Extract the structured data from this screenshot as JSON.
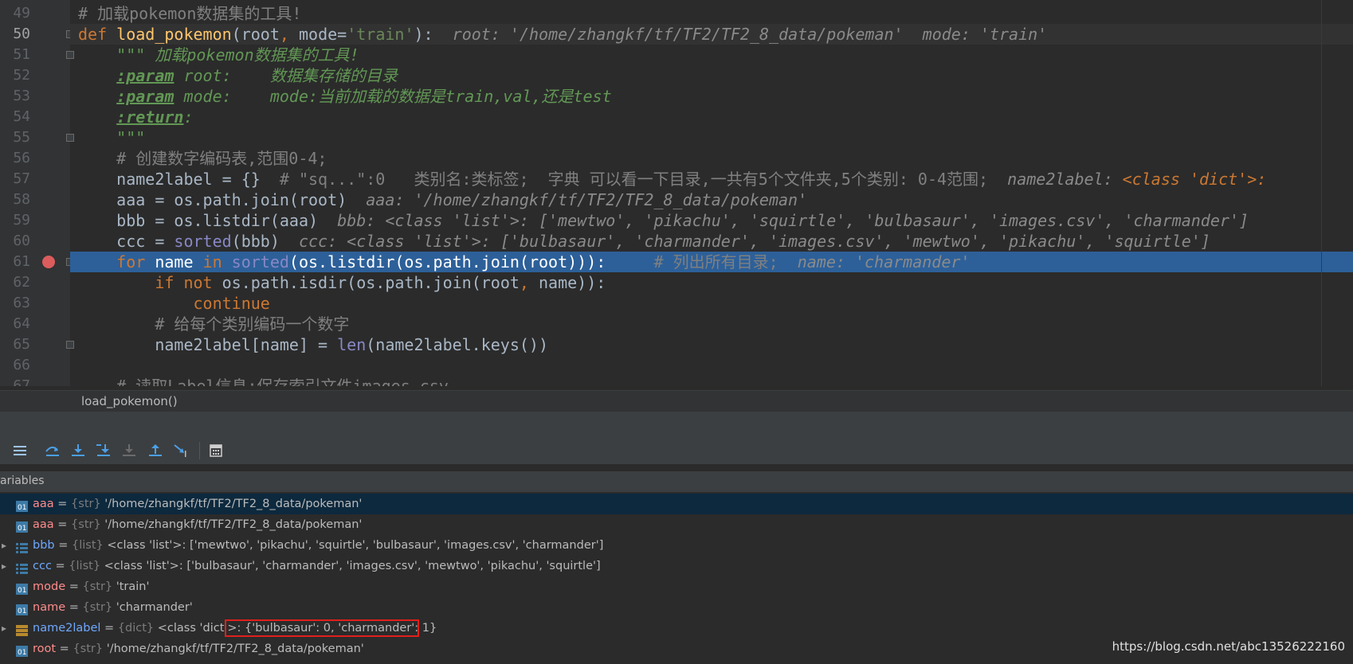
{
  "editor": {
    "lines": [
      {
        "num": "49",
        "segs": [
          {
            "c": "cm",
            "t": "# 加载pokemon数据集的工具!"
          }
        ]
      },
      {
        "num": "50",
        "current": true,
        "segs": [
          {
            "c": "kw",
            "t": "def "
          },
          {
            "c": "fn",
            "t": "load_pokemon"
          },
          {
            "c": "",
            "t": "(root"
          },
          {
            "c": "kw",
            "t": ", "
          },
          {
            "c": "",
            "t": "mode="
          },
          {
            "c": "str",
            "t": "'train'"
          },
          {
            "c": "",
            "t": "):  "
          },
          {
            "c": "hint",
            "t": "root: '/home/zhangkf/tf/TF2/TF2_8_data/pokeman'  mode: 'train'"
          }
        ]
      },
      {
        "num": "51",
        "segs": [
          {
            "c": "doc",
            "t": "    \"\"\" 加载pokemon数据集的工具!"
          }
        ]
      },
      {
        "num": "52",
        "segs": [
          {
            "c": "doc",
            "t": "    "
          },
          {
            "c": "tag",
            "t": ":param"
          },
          {
            "c": "doc",
            "t": " root:    数据集存储的目录"
          }
        ]
      },
      {
        "num": "53",
        "segs": [
          {
            "c": "doc",
            "t": "    "
          },
          {
            "c": "tag",
            "t": ":param"
          },
          {
            "c": "doc",
            "t": " mode:    mode:当前加载的数据是train,val,还是test"
          }
        ]
      },
      {
        "num": "54",
        "segs": [
          {
            "c": "doc",
            "t": "    "
          },
          {
            "c": "tag",
            "t": ":return"
          },
          {
            "c": "doc",
            "t": ":"
          }
        ]
      },
      {
        "num": "55",
        "segs": [
          {
            "c": "doc",
            "t": "    \"\"\""
          }
        ]
      },
      {
        "num": "56",
        "segs": [
          {
            "c": "cm",
            "t": "    # 创建数字编码表,范围0-4;"
          }
        ]
      },
      {
        "num": "57",
        "segs": [
          {
            "c": "",
            "t": "    name2label = {}  "
          },
          {
            "c": "cm",
            "t": "# \"sq...\":0   类别名:类标签;  字典 可以看一下目录,一共有5个文件夹,5个类别: 0-4范围;  "
          },
          {
            "c": "hint",
            "t": "name2label: "
          },
          {
            "c": "hintcls",
            "t": "<class 'dict'>:"
          }
        ]
      },
      {
        "num": "58",
        "segs": [
          {
            "c": "",
            "t": "    aaa = os.path.join(root)  "
          },
          {
            "c": "hint",
            "t": "aaa: '/home/zhangkf/tf/TF2/TF2_8_data/pokeman'"
          }
        ]
      },
      {
        "num": "59",
        "segs": [
          {
            "c": "",
            "t": "    bbb = os.listdir(aaa)  "
          },
          {
            "c": "hint",
            "t": "bbb: <class 'list'>: ['mewtwo', 'pikachu', 'squirtle', 'bulbasaur', 'images.csv', 'charmander']"
          }
        ]
      },
      {
        "num": "60",
        "segs": [
          {
            "c": "",
            "t": "    ccc = "
          },
          {
            "c": "bi",
            "t": "sorted"
          },
          {
            "c": "",
            "t": "(bbb)  "
          },
          {
            "c": "hint",
            "t": "ccc: <class 'list'>: ['bulbasaur', 'charmander', 'images.csv', 'mewtwo', 'pikachu', 'squirtle']"
          }
        ]
      },
      {
        "num": "61",
        "exec": true,
        "segs": [
          {
            "c": "kw",
            "t": "    for "
          },
          {
            "c": "",
            "t": "name "
          },
          {
            "c": "kw",
            "t": "in "
          },
          {
            "c": "bi",
            "t": "sorted"
          },
          {
            "c": "",
            "t": "(os.listdir(os.path.join(root))):     "
          },
          {
            "c": "cm",
            "t": "# 列出所有目录;  "
          },
          {
            "c": "hint",
            "t": "name: 'charmander'"
          }
        ]
      },
      {
        "num": "62",
        "segs": [
          {
            "c": "kw",
            "t": "        if not "
          },
          {
            "c": "",
            "t": "os.path.isdir(os.path.join(root"
          },
          {
            "c": "kw",
            "t": ", "
          },
          {
            "c": "",
            "t": "name)):"
          }
        ]
      },
      {
        "num": "63",
        "segs": [
          {
            "c": "kw",
            "t": "            continue"
          }
        ]
      },
      {
        "num": "64",
        "segs": [
          {
            "c": "cm",
            "t": "        # 给每个类别编码一个数字"
          }
        ]
      },
      {
        "num": "65",
        "segs": [
          {
            "c": "",
            "t": "        name2label[name] = "
          },
          {
            "c": "bi",
            "t": "len"
          },
          {
            "c": "",
            "t": "(name2label.keys())"
          }
        ]
      },
      {
        "num": "66",
        "segs": [
          {
            "c": "",
            "t": ""
          }
        ]
      },
      {
        "num": "67",
        "segs": [
          {
            "c": "cm",
            "t": "    # 读取Label信息;保存索引文件images.csv"
          }
        ]
      }
    ]
  },
  "breadcrumb": {
    "label": "load_pokemon()"
  },
  "variables": {
    "header": "ariables",
    "rows": [
      {
        "expand": false,
        "icon": "str",
        "name": "aaa",
        "kind": "str",
        "type": "{str}",
        "value": " '/home/zhangkf/tf/TF2/TF2_8_data/pokeman'",
        "selected": true
      },
      {
        "expand": false,
        "icon": "str",
        "name": "aaa",
        "kind": "str",
        "type": "{str}",
        "value": " '/home/zhangkf/tf/TF2/TF2_8_data/pokeman'"
      },
      {
        "expand": true,
        "icon": "list",
        "name": "bbb",
        "kind": "lst",
        "type": "{list}",
        "value": " <class 'list'>: ['mewtwo', 'pikachu', 'squirtle', 'bulbasaur', 'images.csv', 'charmander']"
      },
      {
        "expand": true,
        "icon": "list",
        "name": "ccc",
        "kind": "lst",
        "type": "{list}",
        "value": " <class 'list'>: ['bulbasaur', 'charmander', 'images.csv', 'mewtwo', 'pikachu', 'squirtle']"
      },
      {
        "expand": false,
        "icon": "str",
        "name": "mode",
        "kind": "str",
        "type": "{str}",
        "value": " 'train'"
      },
      {
        "expand": false,
        "icon": "str",
        "name": "name",
        "kind": "str",
        "type": "{str}",
        "value": " 'charmander'"
      },
      {
        "expand": true,
        "icon": "dict",
        "name": "name2label",
        "kind": "lst",
        "type": "{dict}",
        "value": " <class 'dict'>: {'bulbasaur': 0, 'charmander': 1}",
        "highlight": true
      },
      {
        "expand": false,
        "icon": "str",
        "name": "root",
        "kind": "str",
        "type": "{str}",
        "value": " '/home/zhangkf/tf/TF2/TF2_8_data/pokeman'"
      }
    ]
  },
  "watermark": "https://blog.csdn.net/abc13526222160",
  "colors": {
    "exec_line": "#2d6099",
    "breakpoint": "#db5c5c",
    "highlight_box": "#e0201b"
  }
}
